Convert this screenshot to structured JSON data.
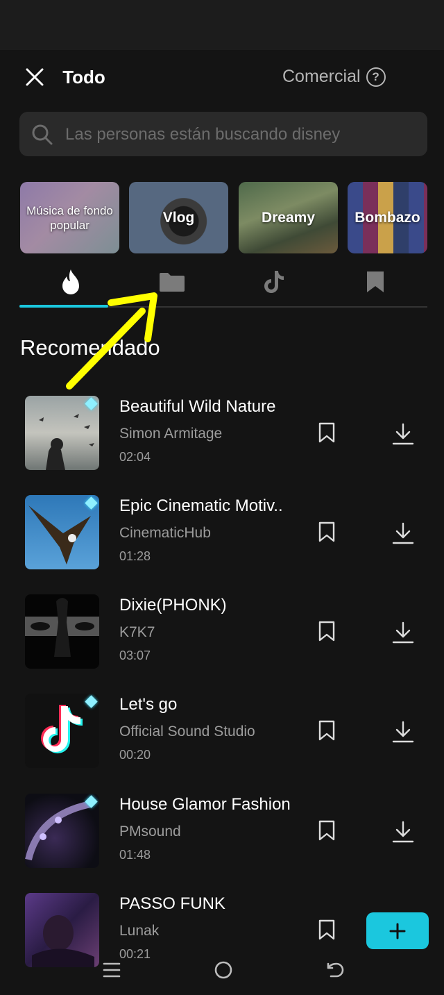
{
  "header": {
    "title": "Todo",
    "commercial_label": "Comercial",
    "help_glyph": "?"
  },
  "search": {
    "placeholder": "Las personas están buscando disney"
  },
  "categories": [
    {
      "label": "Música de fondo popular"
    },
    {
      "label": "Vlog"
    },
    {
      "label": "Dreamy"
    },
    {
      "label": "Bombazo"
    }
  ],
  "tabs": [
    {
      "icon": "fire-icon",
      "active": true
    },
    {
      "icon": "folder-icon",
      "active": false
    },
    {
      "icon": "tiktok-icon",
      "active": false
    },
    {
      "icon": "bookmark-icon",
      "active": false
    }
  ],
  "section": {
    "title": "Recomendado"
  },
  "tracks": [
    {
      "name": "Beautiful Wild Nature",
      "artist": "Simon Armitage",
      "duration": "02:04",
      "premium": true
    },
    {
      "name": "Epic Cinematic Motiv..",
      "artist": "CinematicHub",
      "duration": "01:28",
      "premium": true
    },
    {
      "name": "Dixie(PHONK)",
      "artist": "K7K7",
      "duration": "03:07",
      "premium": false
    },
    {
      "name": "Let's go",
      "artist": "Official Sound Studio",
      "duration": "00:20",
      "premium": true
    },
    {
      "name": "House Glamor Fashion",
      "artist": "PMsound",
      "duration": "01:48",
      "premium": true
    },
    {
      "name": "PASSO FUNK",
      "artist": "Lunak",
      "duration": "00:21",
      "premium": false
    }
  ],
  "fab": {
    "icon": "plus-icon"
  },
  "navbar": {
    "buttons": [
      "menu-icon",
      "home-icon",
      "back-icon"
    ]
  },
  "colors": {
    "accent": "#1bc7de",
    "background": "#141414",
    "annotation_arrow": "#ffff00"
  }
}
